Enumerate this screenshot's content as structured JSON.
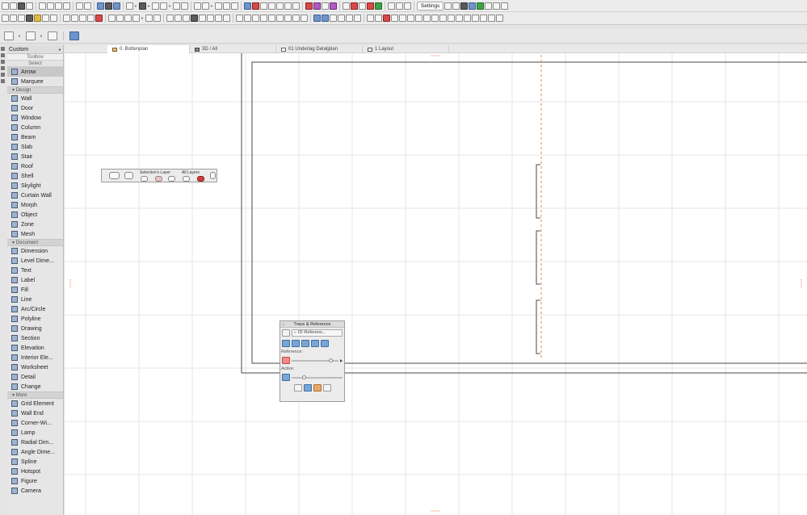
{
  "toolbar": {
    "settings_label": "Settings"
  },
  "toolbox": {
    "dropdown_label": "Custom",
    "title": "Toolbox",
    "select_group": "Select",
    "select_tools": [
      "Arrow",
      "Marquee"
    ],
    "design_group": "Design",
    "design_tools": [
      "Wall",
      "Door",
      "Window",
      "Column",
      "Beam",
      "Slab",
      "Stair",
      "Roof",
      "Shell",
      "Skylight",
      "Curtain Wall",
      "Morph",
      "Object",
      "Zone",
      "Mesh"
    ],
    "document_group": "Document",
    "document_tools": [
      "Dimension",
      "Level Dime...",
      "Text",
      "Label",
      "Fill",
      "Line",
      "Arc/Circle",
      "Polyline",
      "Drawing",
      "Section",
      "Elevation",
      "Interior Ele...",
      "Worksheet",
      "Detail",
      "Change"
    ],
    "more_group": "More",
    "more_tools": [
      "Grid Element",
      "Wall End",
      "Corner-Wi...",
      "Lamp",
      "Radial Dim...",
      "Angle Dime...",
      "Spline",
      "Hotspot",
      "Figure",
      "Camera"
    ]
  },
  "tabs": [
    "0. Bottenplan",
    "3D / All",
    "01 Underlag Detaljplan",
    "1 Layout"
  ],
  "layer_palette": {
    "selection_label": "Selection's Layer",
    "all_label": "All Layers"
  },
  "trace": {
    "title": "Trace & Reference",
    "reference_popup": "02 Referens...",
    "reference_label": "Reference:",
    "active_label": "Active:"
  },
  "colors": {
    "dash_line": "#e8835a",
    "frame": "#4a4a4a",
    "grid": "#e6e6e6",
    "accent_blue": "#6f94c9"
  }
}
